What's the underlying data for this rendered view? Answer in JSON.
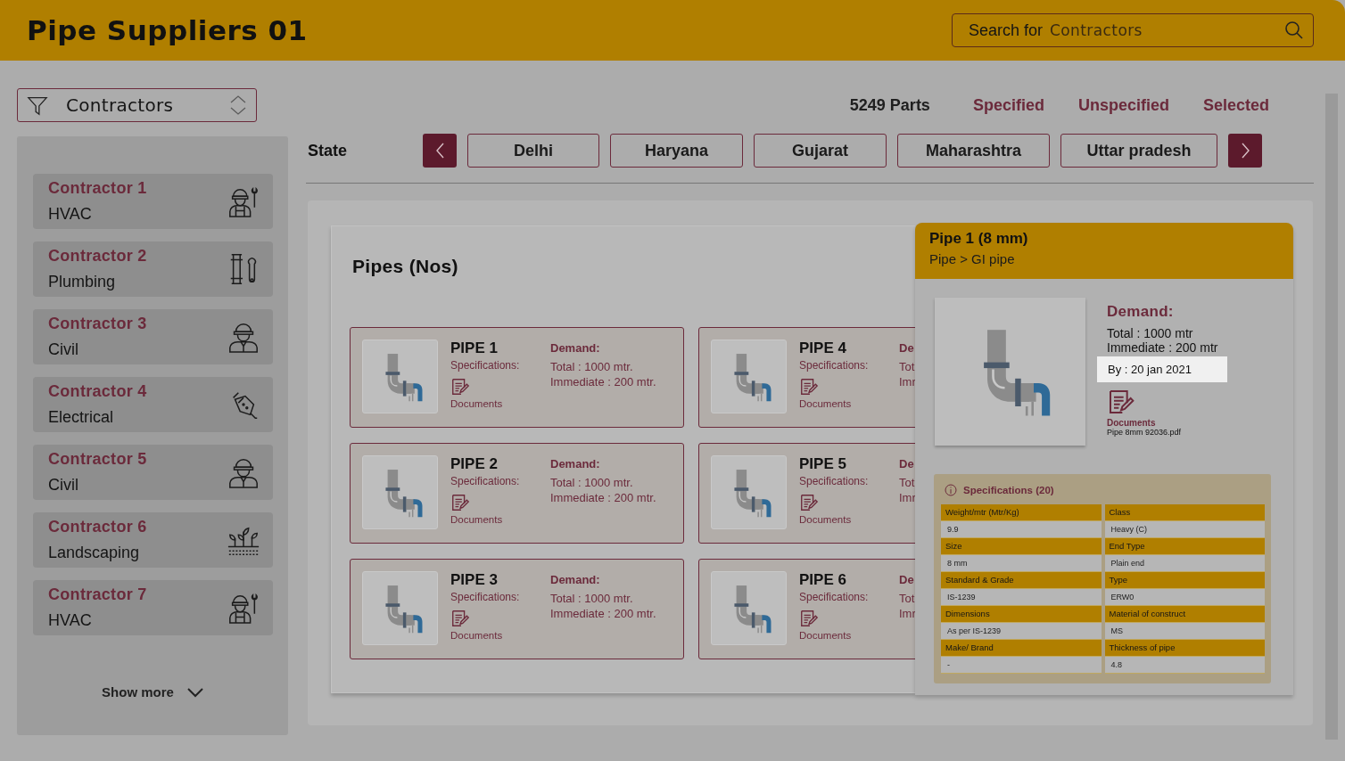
{
  "header": {
    "title": "Pipe Suppliers 01",
    "search": {
      "label": "Search for",
      "placeholder": "Contractors"
    }
  },
  "filter": {
    "value": "Contractors"
  },
  "stats": {
    "parts": "5249 Parts",
    "links": [
      "Specified",
      "Unspecified",
      "Selected"
    ]
  },
  "contractors": [
    {
      "name": "Contractor 1",
      "category": "HVAC",
      "kind": "worker-wrench"
    },
    {
      "name": "Contractor 2",
      "category": "Plumbing",
      "kind": "pipe-wrench"
    },
    {
      "name": "Contractor 3",
      "category": "Civil",
      "kind": "worker"
    },
    {
      "name": "Contractor 4",
      "category": "Electrical",
      "kind": "plug"
    },
    {
      "name": "Contractor 5",
      "category": "Civil",
      "kind": "worker"
    },
    {
      "name": "Contractor 6",
      "category": "Landscaping",
      "kind": "plants"
    },
    {
      "name": "Contractor 7",
      "category": "HVAC",
      "kind": "worker-wrench"
    }
  ],
  "show_more": "Show more",
  "state_filter": {
    "label": "State",
    "states": [
      "Delhi",
      "Haryana",
      "Gujarat",
      "Maharashtra",
      "Uttar pradesh"
    ]
  },
  "pipes": {
    "title": "Pipes (Nos)",
    "items": [
      {
        "name": "PIPE 1",
        "specs": "Specifications:",
        "documents": "Documents",
        "demand": "Demand:",
        "total": "Total : 1000 mtr.",
        "immediate": "Immediate : 200 mtr."
      },
      {
        "name": "PIPE 4",
        "specs": "Specifications:",
        "documents": "Documents",
        "demand": "De",
        "total": "Tot",
        "immediate": "Imr"
      },
      {
        "name": "PIPE 2",
        "specs": "Specifications:",
        "documents": "Documents",
        "demand": "Demand:",
        "total": "Total : 1000 mtr.",
        "immediate": "Immediate : 200 mtr."
      },
      {
        "name": "PIPE 5",
        "specs": "Specifications:",
        "documents": "Documents",
        "demand": "De",
        "total": "Tot",
        "immediate": "Imr"
      },
      {
        "name": "PIPE 3",
        "specs": "Specifications:",
        "documents": "Documents",
        "demand": "Demand:",
        "total": "Total : 1000 mtr.",
        "immediate": "Immediate : 200 mtr."
      },
      {
        "name": "PIPE 6",
        "specs": "Specifications:",
        "documents": "Documents",
        "demand": "De",
        "total": "Tot",
        "immediate": "Imr"
      }
    ]
  },
  "detail": {
    "title": "Pipe 1 (8 mm)",
    "breadcrumb": "Pipe > GI pipe",
    "demand": "Demand:",
    "total": "Total : 1000 mtr",
    "immediate": "Immediate : 200 mtr",
    "by": "By : 20 jan 2021",
    "documents": "Documents",
    "file": "Pipe 8mm 92036.pdf",
    "specifications": {
      "title": "Specifications (20)",
      "rows": [
        {
          "label": "Weight/mtr (Mtr/Kg)",
          "value": "9.9"
        },
        {
          "label": "Class",
          "value": "Heavy (C)"
        },
        {
          "label": "Size",
          "value": "8 mm"
        },
        {
          "label": "End Type",
          "value": "Plain end"
        },
        {
          "label": "Standard & Grade",
          "value": "IS-1239"
        },
        {
          "label": "Type",
          "value": "ERW0"
        },
        {
          "label": "Dimensions",
          "value": "As per IS-1239"
        },
        {
          "label": "Material of construct",
          "value": "MS"
        },
        {
          "label": "Make/ Brand",
          "value": "-"
        },
        {
          "label": "Thickness of pipe",
          "value": "4.8"
        }
      ]
    }
  }
}
